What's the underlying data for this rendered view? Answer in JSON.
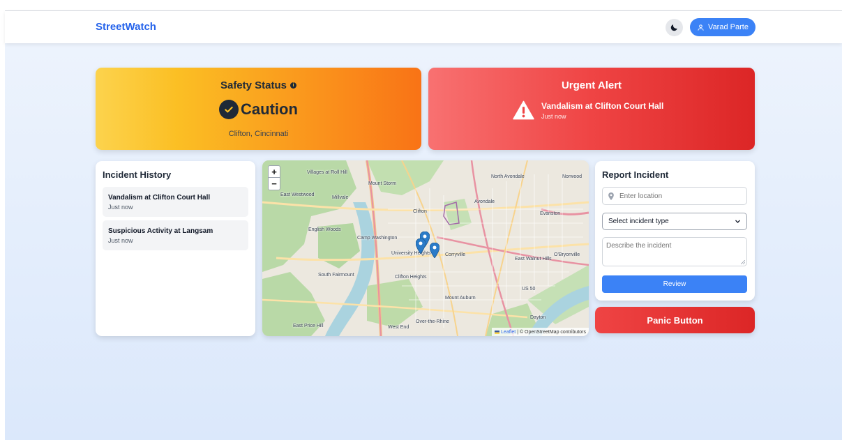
{
  "nav": {
    "brand": "StreetWatch",
    "user_name": "Varad Parte",
    "theme_icon": "moon-icon",
    "user_icon": "user-icon"
  },
  "safety": {
    "title": "Safety Status",
    "status": "Caution",
    "location": "Clifton, Cincinnati",
    "colors": {
      "from": "#fcd34d",
      "to": "#f97316"
    }
  },
  "alert": {
    "title": "Urgent Alert",
    "message": "Vandalism at Clifton Court Hall",
    "time": "Just now",
    "icon": "warning-icon",
    "colors": {
      "from": "#f87171",
      "to": "#dc2626"
    }
  },
  "history": {
    "title": "Incident History",
    "items": [
      {
        "title": "Vandalism at Clifton Court Hall",
        "time": "Just now"
      },
      {
        "title": "Suspicious Activity at Langsam",
        "time": "Just now"
      }
    ]
  },
  "map": {
    "zoom_in": "+",
    "zoom_out": "−",
    "attribution_leaflet": "Leaflet",
    "attribution_osm": "| © OpenStreetMap contributors",
    "labels": [
      "Villages at Roll Hill",
      "East Westwood",
      "Millvale",
      "English Woods",
      "Camp Washington",
      "Clifton",
      "University Heights",
      "Corryville",
      "Avondale",
      "North Avondale",
      "Norwood",
      "Evanston",
      "East Walnut Hills",
      "O'Bryonville",
      "Clifton Heights",
      "Mount Auburn",
      "South Fairmount",
      "East Price Hill",
      "West End",
      "Over-the-Rhine",
      "Dayton",
      "US 50",
      "Mount Storm"
    ]
  },
  "report": {
    "title": "Report Incident",
    "location_placeholder": "Enter location",
    "type_selected": "Select incident type",
    "description_placeholder": "Describe the incident",
    "review_label": "Review"
  },
  "panic": {
    "label": "Panic Button"
  },
  "accent_color": "#3b82f6"
}
